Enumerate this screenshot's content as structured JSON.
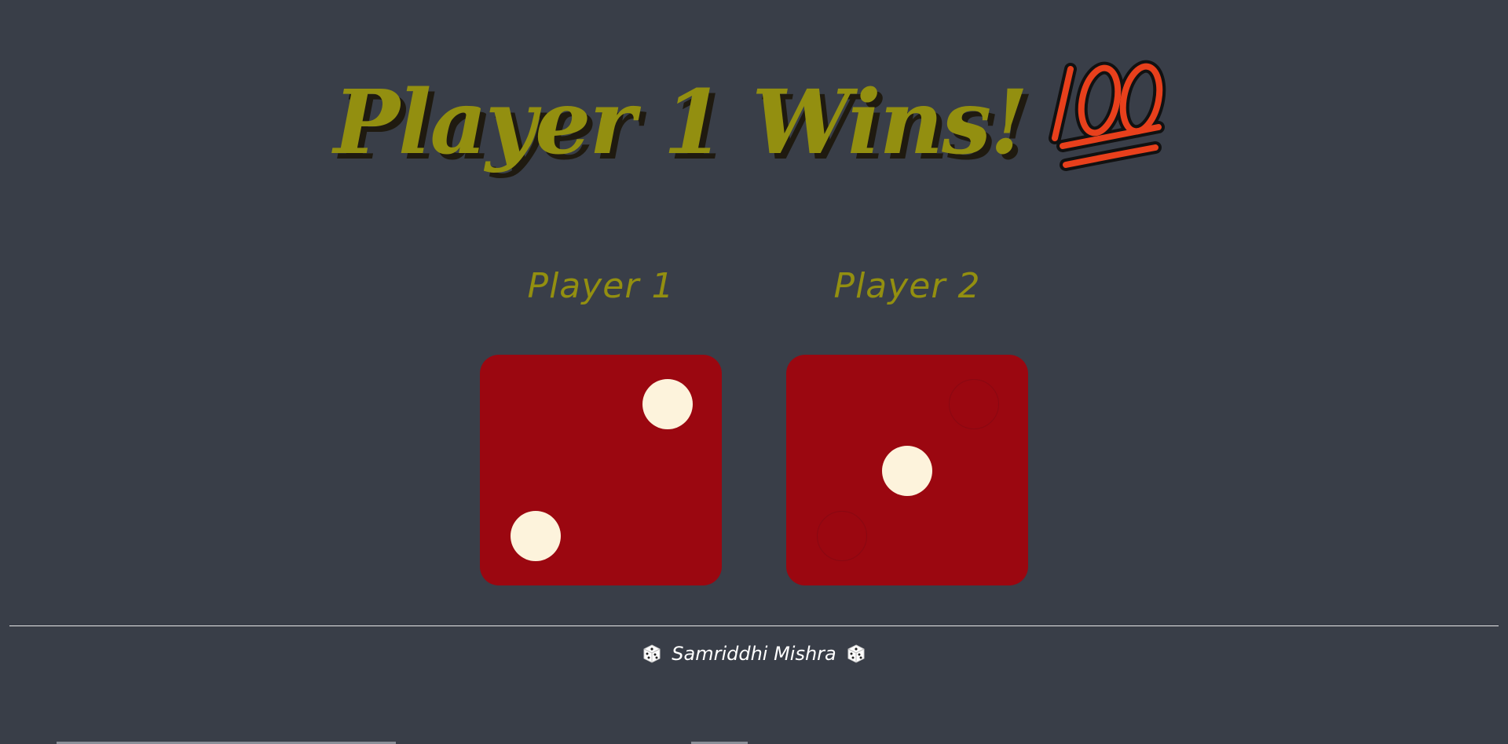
{
  "header": {
    "title": "Player 1 Wins!",
    "emoji_icon": "hundred-points-icon",
    "title_color": "#938f10",
    "emoji_color": "#e8401c"
  },
  "players": [
    {
      "label": "Player 1",
      "dice_value": 2
    },
    {
      "label": "Player 2",
      "dice_value": 1
    }
  ],
  "colors": {
    "background": "#393e48",
    "dice": "#9b0710",
    "pip": "#fdf3dc"
  },
  "footer": {
    "author": "Samriddhi Mishra",
    "left_icon": "dice-icon",
    "right_icon": "dice-icon"
  }
}
